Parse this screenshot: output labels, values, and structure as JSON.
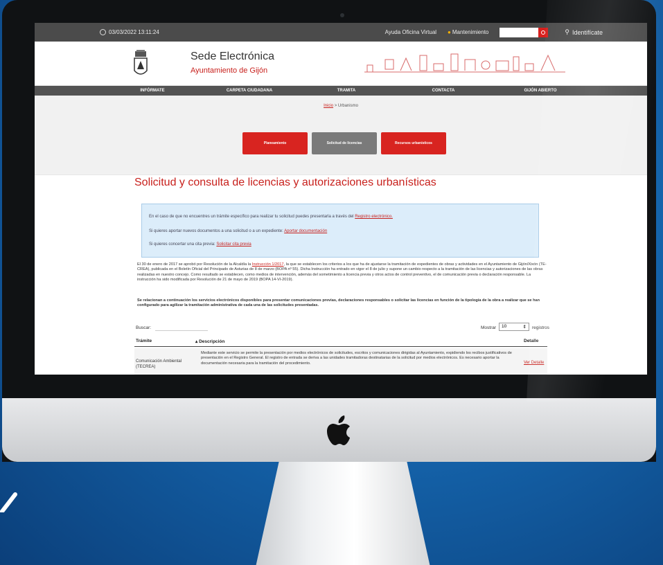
{
  "topbar": {
    "datetime": "03/03/2022 13:11:24",
    "virtual_assistant": "Ayuda Oficina Virtual",
    "maintenance": "Mantenimiento",
    "login": "Identifícate"
  },
  "header": {
    "title": "Sede Electrónica",
    "subtitle": "Ayuntamiento de Gijón"
  },
  "nav": [
    "INFÓRMATE",
    "CARPETA CIUDADANA",
    "TRAMITA",
    "CONTACTA",
    "GIJÓN ABIERTO"
  ],
  "breadcrumb": {
    "home": "Inicio",
    "current": " > Urbanismo"
  },
  "actions": [
    "Planeamiento",
    "Solicitud de licencias",
    "Recursos urbanísticos"
  ],
  "page": {
    "title": "Solicitud y consulta de licencias y autorizaciones urbanísticas"
  },
  "info": {
    "line1": "En el caso de que no encuentres un trámite específico para realizar tu solicitud puedes presentarla a través del",
    "line1_link": "Registro electrónico.",
    "line2": "Si quieres aportar nuevos documentos a una solicitud o a un expediente:",
    "line2_link": "Aportar documentación",
    "line3": "Si quieres concertar una cita previa:",
    "line3_link": "Solicitar cita previa"
  },
  "body": {
    "p1_start": "El 30 de enero de 2017 se aprobó por Resolución de la Alcaldía la",
    "p1_link": "Instrucción 1/2017",
    "p1_rest": ", la que se establecen los criterios a los que ha de ajustarse la tramitación de expedientes de obras y actividades en el Ayuntamiento de Gijón/Xixón (TE-CREA), publicada en el Boletín Oficial del Principado de Asturias de 8 de marzo (BOPA nº 55). Dicha Instrucción ha entrado en vigor el 8 de julio y supone un cambio respecto a la tramitación de las licencias y autorizaciones de las obras realizadas en nuestro concejo. Como resultado se establecen, como medios de intervención, además del sometimiento a licencia previa y otros actos de control preventivo, el de comunicación previa o declaración responsable. La instrucción ha sido modificada por Resolución de 21 de mayo de 2019 (BOPA 14-VI-2019).",
    "p2": "Se relacionan a continuación los servicios electrónicos disponibles para presentar comunicaciones previas, declaraciones responsables o solicitar las licencias en función de la tipología de la obra a realizar que se han configurado para agilizar la tramitación administrativa de cada una de las solicitudes presentadas."
  },
  "table": {
    "search_label": "Buscar:",
    "show_label": "Mostrar",
    "show_value": "10",
    "records_label": "registros",
    "headers": [
      "Trámite",
      "Descripción",
      "Detalle"
    ],
    "rows": [
      {
        "tramite": "Comunicación Ambiental (TECREA)",
        "descripcion": "Mediante este servicio se permite la presentación por medios electrónicos de solicitudes, escritos y comunicaciones dirigidas al Ayuntamiento, expidiendo los recibos justificativos de presentación en el Registro General. El registro de entrada se deriva a las unidades tramitadoras destinatarias de la solicitud por medios electrónicos. Es necesario aportar la documentación necesaria para la tramitación del procedimiento.",
        "detalle": "Ver Detalle"
      }
    ]
  },
  "colors": {
    "accent": "#d82420",
    "nav": "#535353",
    "topbar": "#4b4b4b",
    "info_bg": "#dcedfa"
  }
}
